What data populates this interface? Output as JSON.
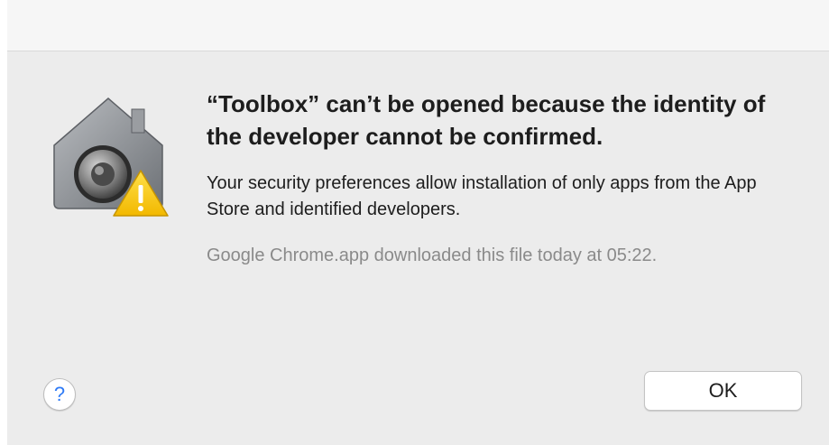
{
  "dialog": {
    "headline": "“Toolbox” can’t be opened because the identity of the developer cannot be confirmed.",
    "body": "Your security preferences allow installation of only apps from the App Store and identified developers.",
    "source_note": "Google Chrome.app downloaded this file today at 05:22.",
    "help_label": "?",
    "ok_label": "OK",
    "icon": "gatekeeper-warning-icon"
  },
  "colors": {
    "dialog_background": "#ececec",
    "help_accent": "#2f7bf6",
    "warning_yellow": "#f5c400",
    "muted_text": "#8a8a8a"
  }
}
